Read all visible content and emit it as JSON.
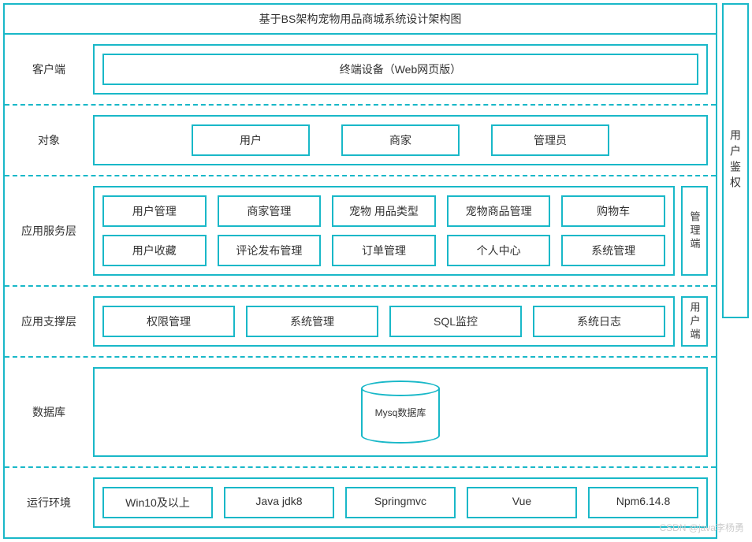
{
  "title": "基于BS架构宠物用品商城系统设计架构图",
  "auth_label": "用户鉴权",
  "side_admin": "管理端",
  "side_user": "用户端",
  "rows": {
    "client": {
      "label": "客户端",
      "items": [
        "终端设备（Web网页版）"
      ]
    },
    "object": {
      "label": "对象",
      "items": [
        "用户",
        "商家",
        "管理员"
      ]
    },
    "service": {
      "label": "应用服务层",
      "row1": [
        "用户管理",
        "商家管理",
        "宠物 用品类型",
        "宠物商品管理",
        "购物车"
      ],
      "row2": [
        "用户收藏",
        "评论发布管理",
        "订单管理",
        "个人中心",
        "系统管理"
      ]
    },
    "support": {
      "label": "应用支撑层",
      "items": [
        "权限管理",
        "系统管理",
        "SQL监控",
        "系统日志"
      ]
    },
    "database": {
      "label": "数据库",
      "cylinder": "Mysq数据库"
    },
    "runtime": {
      "label": "运行环境",
      "items": [
        "Win10及以上",
        "Java jdk8",
        "Springmvc",
        "Vue",
        "Npm6.14.8"
      ]
    }
  },
  "watermark": "CSDN @java李杨勇"
}
